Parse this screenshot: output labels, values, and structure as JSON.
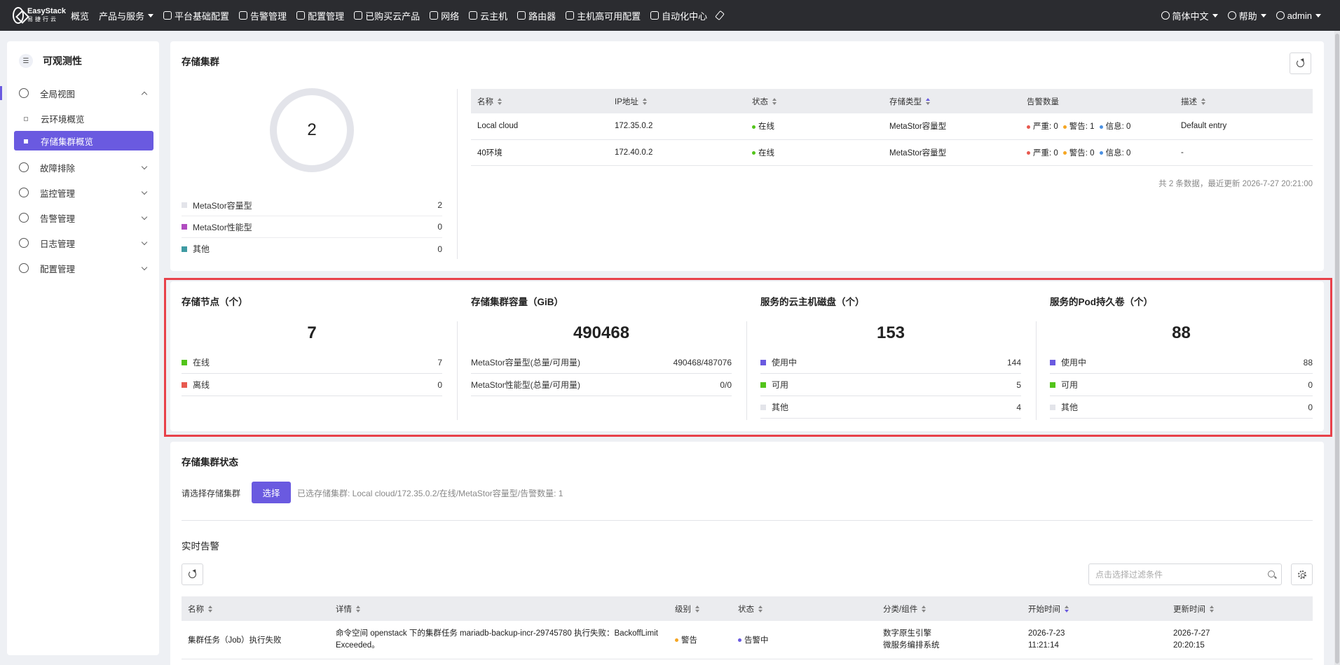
{
  "brand": {
    "name": "EasyStack",
    "sub": "易捷行云"
  },
  "topnav": {
    "items": [
      "概览",
      "产品与服务",
      "平台基础配置",
      "告警管理",
      "配置管理",
      "已购买云产品",
      "网络",
      "云主机",
      "路由器",
      "主机高可用配置",
      "自动化中心"
    ],
    "language": "简体中文",
    "help": "帮助",
    "user": "admin"
  },
  "sidebar": {
    "title": "可观测性",
    "items": [
      {
        "label": "全局视图"
      },
      {
        "label": "故障排除"
      },
      {
        "label": "监控管理"
      },
      {
        "label": "告警管理"
      },
      {
        "label": "日志管理"
      },
      {
        "label": "配置管理"
      }
    ],
    "subitems": [
      "云环境概览",
      "存储集群概览"
    ]
  },
  "cluster": {
    "title": "存储集群",
    "total": "2",
    "legend": [
      {
        "label": "MetaStor容量型",
        "value": "2",
        "color": "#e3e4ea"
      },
      {
        "label": "MetaStor性能型",
        "value": "0",
        "color": "#b04cc0"
      },
      {
        "label": "其他",
        "value": "0",
        "color": "#3f9ba3"
      }
    ],
    "columns": [
      "名称",
      "IP地址",
      "状态",
      "存储类型",
      "告警数量",
      "描述"
    ],
    "rows": [
      {
        "name": "Local cloud",
        "ip": "172.35.0.2",
        "status": "在线",
        "type": "MetaStor容量型",
        "severe": "严重: 0",
        "warn": "警告: 1",
        "info": "信息: 0",
        "desc": "Default entry"
      },
      {
        "name": "40环境",
        "ip": "172.40.0.2",
        "status": "在线",
        "type": "MetaStor容量型",
        "severe": "严重: 0",
        "warn": "警告: 0",
        "info": "信息: 0",
        "desc": "-"
      }
    ],
    "footer": "共 2 条数据，最近更新  2026-7-27 20:21:00"
  },
  "stats": [
    {
      "title": "存储节点（个）",
      "value": "7",
      "rows": [
        {
          "label": "在线",
          "value": "7",
          "color": "#52c41a"
        },
        {
          "label": "离线",
          "value": "0",
          "color": "#e8594f"
        }
      ]
    },
    {
      "title": "存储集群容量（GiB）",
      "value": "490468",
      "rows": [
        {
          "label": "MetaStor容量型(总量/可用量)",
          "value": "490468/487076",
          "color": ""
        },
        {
          "label": "MetaStor性能型(总量/可用量)",
          "value": "0/0",
          "color": ""
        }
      ]
    },
    {
      "title": "服务的云主机磁盘（个）",
      "value": "153",
      "rows": [
        {
          "label": "使用中",
          "value": "144",
          "color": "#6a5ae0"
        },
        {
          "label": "可用",
          "value": "5",
          "color": "#52c41a"
        },
        {
          "label": "其他",
          "value": "4",
          "color": "#e3e4ea"
        }
      ]
    },
    {
      "title": "服务的Pod持久卷（个）",
      "value": "88",
      "rows": [
        {
          "label": "使用中",
          "value": "88",
          "color": "#6a5ae0"
        },
        {
          "label": "可用",
          "value": "0",
          "color": "#52c41a"
        },
        {
          "label": "其他",
          "value": "0",
          "color": "#e3e4ea"
        }
      ]
    }
  ],
  "status": {
    "title": "存储集群状态",
    "choose_label": "请选择存储集群",
    "select_button": "选择",
    "selected": "已选存储集群:  Local cloud/172.35.0.2/在线/MetaStor容量型/告警数量: 1",
    "alerts_title": "实时告警",
    "filter_placeholder": "点击选择过滤条件",
    "columns": [
      "名称",
      "详情",
      "级别",
      "状态",
      "分类/组件",
      "开始时间",
      "更新时间"
    ],
    "rows": [
      {
        "name": "集群任务（Job）执行失败",
        "detail": "命令空间 openstack 下的集群任务 mariadb-backup-incr-29745780 执行失败：BackoffLimitExceeded。",
        "level": "警告",
        "state": "告警中",
        "cat1": "数字原生引擎",
        "cat2": "微服务编排系统",
        "start1": "2026-7-23",
        "start2": "11:21:14",
        "upd1": "2026-7-27",
        "upd2": "20:20:15"
      }
    ]
  },
  "colors": {
    "accent": "#6a5ae0",
    "online": "#52c41a",
    "warning": "#f5a623",
    "severe": "#e8594f",
    "info": "#4a90e2",
    "highlight": "#e8414a"
  }
}
